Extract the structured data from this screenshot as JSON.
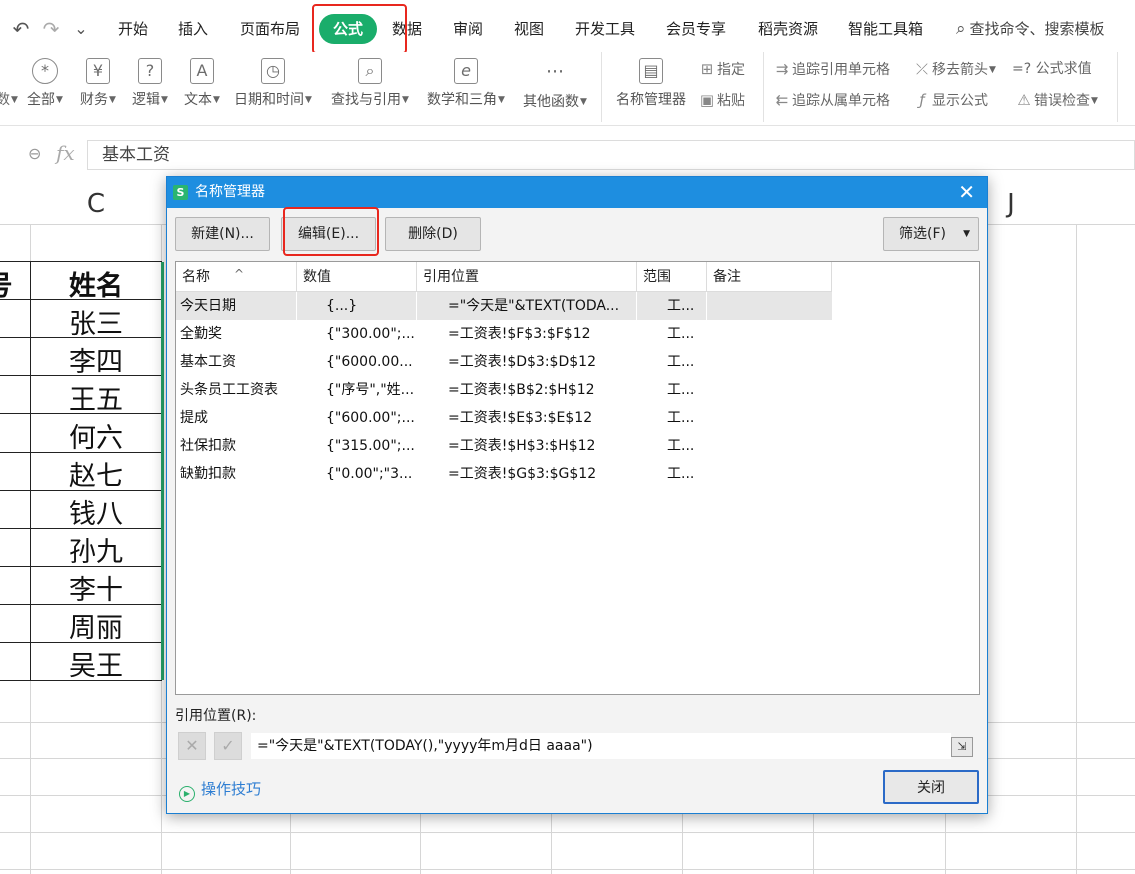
{
  "quick_access": {
    "undo_icon": "↶",
    "redo_icon": "↷",
    "more_icon": "⌄"
  },
  "menu_tabs": [
    "开始",
    "插入",
    "页面布局",
    "公式",
    "数据",
    "审阅",
    "视图",
    "开发工具",
    "会员专享",
    "稻壳资源",
    "智能工具箱"
  ],
  "active_tab": "公式",
  "search": {
    "label": "查找命令、搜索模板"
  },
  "ribbon": {
    "partial_left": "数",
    "groups": [
      {
        "label": "全部",
        "icon": "*"
      },
      {
        "label": "财务",
        "icon": "¥"
      },
      {
        "label": "逻辑",
        "icon": "?"
      },
      {
        "label": "文本",
        "icon": "A"
      },
      {
        "label": "日期和时间",
        "icon": "◷"
      },
      {
        "label": "查找与引用",
        "icon": "⌕"
      },
      {
        "label": "数学和三角",
        "icon": "e"
      },
      {
        "label": "其他函数",
        "icon": "···"
      },
      {
        "label": "名称管理器",
        "icon": "▤"
      }
    ],
    "small": {
      "assign": "指定",
      "paste": "粘贴",
      "trace_precedents": "追踪引用单元格",
      "trace_dependents": "追踪从属单元格",
      "remove_arrows": "移去箭头",
      "show_formulas": "显示公式",
      "evaluate": "=? 公式求值",
      "error_check": "错误检查"
    }
  },
  "formula_bar": {
    "fx": "fx",
    "value": "基本工资"
  },
  "sheet": {
    "col_c": "C",
    "col_j": "J",
    "header_partial": "号",
    "header_name": "姓名",
    "names": [
      "张三",
      "李四",
      "王五",
      "何六",
      "赵七",
      "钱八",
      "孙九",
      "李十",
      "周丽",
      "吴王"
    ]
  },
  "dialog": {
    "title": "名称管理器",
    "logo": "S",
    "buttons": {
      "new": "新建(N)...",
      "edit": "编辑(E)...",
      "delete": "删除(D)",
      "filter": "筛选(F)"
    },
    "columns": [
      "名称",
      "数值",
      "引用位置",
      "范围",
      "备注"
    ],
    "rows": [
      {
        "name": "今天日期",
        "value": "{...}",
        "ref": "=\"今天是\"&TEXT(TODA...",
        "scope": "工..."
      },
      {
        "name": "全勤奖",
        "value": "{\"300.00\";...",
        "ref": "=工资表!$F$3:$F$12",
        "scope": "工..."
      },
      {
        "name": "基本工资",
        "value": "{\"6000.00...",
        "ref": "=工资表!$D$3:$D$12",
        "scope": "工..."
      },
      {
        "name": "头条员工工资表",
        "value": "{\"序号\",\"姓...",
        "ref": "=工资表!$B$2:$H$12",
        "scope": "工..."
      },
      {
        "name": "提成",
        "value": "{\"600.00\";...",
        "ref": "=工资表!$E$3:$E$12",
        "scope": "工..."
      },
      {
        "name": "社保扣款",
        "value": "{\"315.00\";...",
        "ref": "=工资表!$H$3:$H$12",
        "scope": "工..."
      },
      {
        "name": "缺勤扣款",
        "value": "{\"0.00\";\"3...",
        "ref": "=工资表!$G$3:$G$12",
        "scope": "工..."
      }
    ],
    "selected_row": 0,
    "ref_label": "引用位置(R):",
    "ref_value": "=\"今天是\"&TEXT(TODAY(),\"yyyy年m月d日 aaaa\")",
    "tips": "操作技巧",
    "close": "关闭"
  },
  "colors": {
    "accent_green": "#1aad6b",
    "highlight_red": "#e8271e",
    "dialog_blue": "#1e8ee0"
  }
}
